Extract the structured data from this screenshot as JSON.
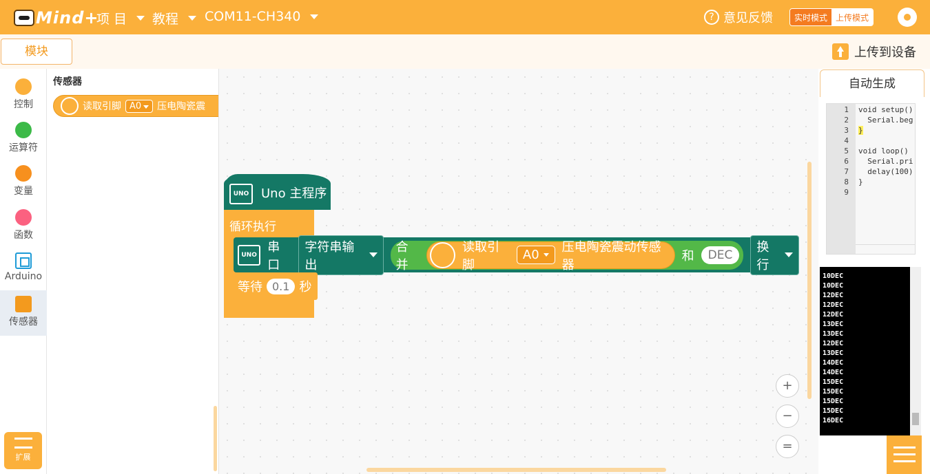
{
  "topbar": {
    "logo_text": "Mind+",
    "menus": [
      {
        "label": "项 目"
      },
      {
        "label": "教程"
      },
      {
        "label": "COM11-CH340"
      }
    ],
    "feedback": "意见反馈",
    "mode_realtime": "实时模式",
    "mode_upload": "上传模式",
    "settings_icon": "gear-icon"
  },
  "subbar": {
    "tab_blocks": "模块",
    "upload_to_device": "上传到设备"
  },
  "categories": [
    {
      "label": "控制",
      "color": "#fbb03b"
    },
    {
      "label": "运算符",
      "color": "#3cba48"
    },
    {
      "label": "变量",
      "color": "#f7901e"
    },
    {
      "label": "函数",
      "color": "#fb6180"
    },
    {
      "label": "Arduino",
      "color": "#1e9bd7"
    },
    {
      "label": "传感器",
      "color": "#f39a1e"
    }
  ],
  "extension": "扩展",
  "flyout": {
    "title": "传感器",
    "block_read": "读取引脚",
    "block_pin": "A0",
    "block_sensor": "压电陶瓷震"
  },
  "workspace": {
    "hat_board": "UNO",
    "hat_label": "Uno 主程序",
    "loop_label": "循环执行",
    "serial_board": "UNO",
    "serial_label": "串口",
    "serial_mode": "字符串输出",
    "merge_label": "合并",
    "read_label": "读取引脚",
    "read_pin": "A0",
    "sensor_label": "压电陶瓷震动传感器",
    "and_label": "和",
    "merge_value": "DEC",
    "newline": "换行",
    "wait_label": "等待",
    "wait_value": "0.1",
    "wait_unit": "秒",
    "zoom_in": "+",
    "zoom_out": "−",
    "zoom_reset": "="
  },
  "codepanel": {
    "tab": "自动生成",
    "lines": [
      {
        "n": "1",
        "code": "void setup()"
      },
      {
        "n": "2",
        "code": "  Serial.beg"
      },
      {
        "n": "3",
        "code": "}"
      },
      {
        "n": "4",
        "code": ""
      },
      {
        "n": "5",
        "code": "void loop()"
      },
      {
        "n": "6",
        "code": "  Serial.pri"
      },
      {
        "n": "7",
        "code": "  delay(100)"
      },
      {
        "n": "8",
        "code": "}"
      },
      {
        "n": "9",
        "code": ""
      }
    ]
  },
  "console": {
    "lines": [
      "10DEC",
      "10DEC",
      "12DEC",
      "12DEC",
      "12DEC",
      "13DEC",
      "13DEC",
      "12DEC",
      "13DEC",
      "14DEC",
      "14DEC",
      "15DEC",
      "15DEC",
      "15DEC",
      "15DEC",
      "16DEC"
    ]
  }
}
